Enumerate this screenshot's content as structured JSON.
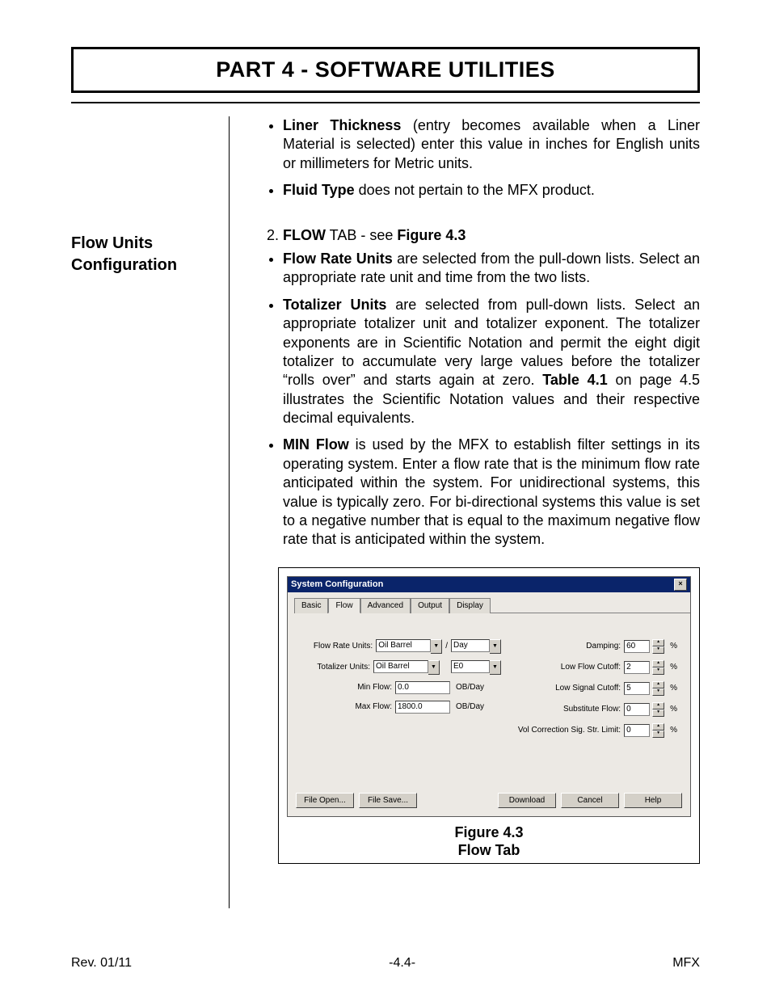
{
  "header": {
    "title": "PART 4 - SOFTWARE UTILITIES"
  },
  "sidebar": {
    "heading": "Flow Units Configuration"
  },
  "topBullets": {
    "b1": {
      "lead": "Liner Thickness",
      "rest": " (entry becomes available when a Liner Material is selected) enter this value in inches for English units or millimeters for Metric units."
    },
    "b2": {
      "lead": "Fluid Type",
      "rest": " does not pertain to the MFX product."
    }
  },
  "numbered": {
    "n2_pre": "FLOW",
    "n2_mid": " TAB - see ",
    "n2_ref": "Figure 4.3"
  },
  "bullets": {
    "fr": {
      "lead": "Flow Rate Units",
      "rest": " are selected from the pull-down lists. Select an appropriate rate unit and time from the two lists."
    },
    "tu": {
      "lead": "Totalizer Units",
      "rest_a": " are selected from pull-down lists. Select an appropriate totalizer unit and totalizer exponent. The totalizer exponents are in Scientific Notation and permit the eight digit totalizer to accumulate very large values before the totalizer “rolls over” and starts again at zero. ",
      "ref": "Table 4.1",
      "rest_b": " on page 4.5 illustrates the Scientific Notation values and their respective decimal equivalents."
    },
    "mf": {
      "lead": "MIN Flow",
      "rest": " is used by the MFX to establish filter settings in its operating system. Enter a flow rate that is the minimum flow rate anticipated within the system. For unidirectional systems, this value is typically zero. For bi-directional systems this value is set to a negative number that is equal to the maximum negative flow rate that is anticipated within the system."
    }
  },
  "dialog": {
    "title": "System Configuration",
    "tabs": [
      "Basic",
      "Flow",
      "Advanced",
      "Output",
      "Display"
    ],
    "activeTab": "Flow",
    "left": {
      "flowRate": {
        "label": "Flow Rate Units:",
        "unit": "Oil Barrel",
        "slash": "/",
        "time": "Day"
      },
      "totalizer": {
        "label": "Totalizer Units:",
        "unit": "Oil Barrel",
        "exp": "E0"
      },
      "min": {
        "label": "Min Flow:",
        "value": "0.0",
        "unit": "OB/Day"
      },
      "max": {
        "label": "Max Flow:",
        "value": "1800.0",
        "unit": "OB/Day"
      }
    },
    "right": {
      "damping": {
        "label": "Damping:",
        "value": "60",
        "unit": "%"
      },
      "lowFlow": {
        "label": "Low Flow Cutoff:",
        "value": "2",
        "unit": "%"
      },
      "lowSig": {
        "label": "Low Signal Cutoff:",
        "value": "5",
        "unit": "%"
      },
      "sub": {
        "label": "Substitute Flow:",
        "value": "0",
        "unit": "%"
      },
      "vol": {
        "label": "Vol Correction Sig. Str. Limit:",
        "value": "0",
        "unit": "%"
      }
    },
    "buttons": {
      "open": "File Open...",
      "save": "File Save...",
      "download": "Download",
      "cancel": "Cancel",
      "help": "Help"
    }
  },
  "caption": {
    "line1": "Figure 4.3",
    "line2": "Flow Tab"
  },
  "footer": {
    "left": "Rev.  01/11",
    "center": "-4.4-",
    "right": "MFX"
  }
}
